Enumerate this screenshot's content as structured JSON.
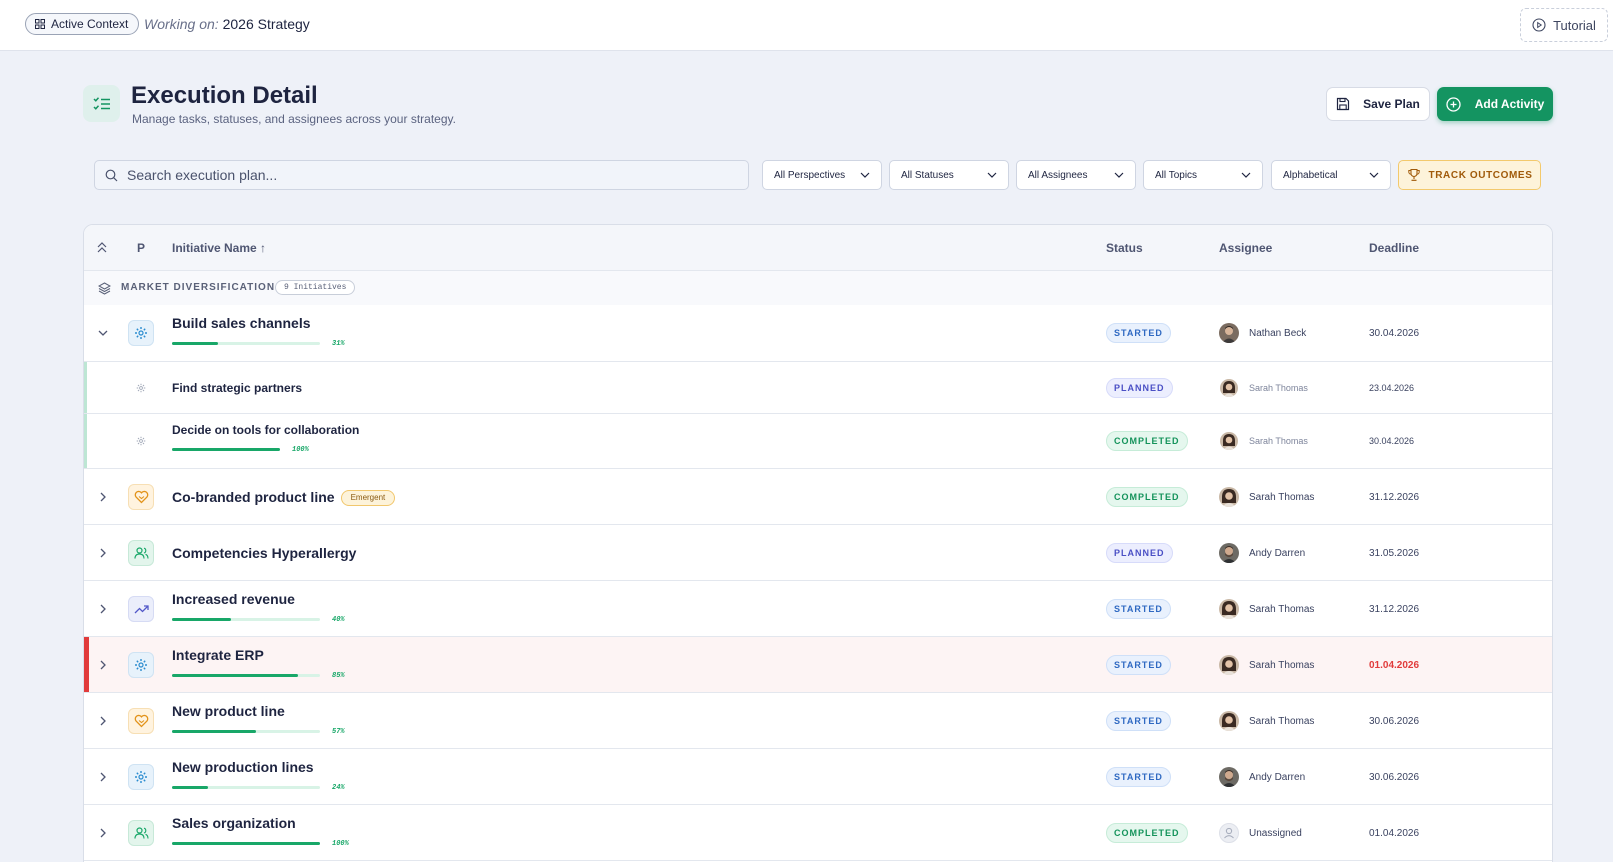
{
  "topbar": {
    "context_label": "Active Context",
    "working_prefix": "Working on:",
    "working_value": "2026 Strategy",
    "tutorial_label": "Tutorial"
  },
  "header": {
    "title": "Execution Detail",
    "subtitle": "Manage tasks, statuses, and assignees across your strategy.",
    "save_label": "Save Plan",
    "add_label": "Add Activity"
  },
  "filters": {
    "search_placeholder": "Search execution plan...",
    "perspectives": "All Perspectives",
    "statuses": "All Statuses",
    "assignees": "All Assignees",
    "topics": "All Topics",
    "sort": "Alphabetical",
    "track_label": "TRACK OUTCOMES"
  },
  "table": {
    "columns": {
      "p": "P",
      "name": "Initiative Name ↑",
      "status": "Status",
      "assignee": "Assignee",
      "deadline": "Deadline"
    },
    "group": {
      "name": "MARKET DIVERSIFICATION",
      "count": "9 Initiatives"
    },
    "rows": [
      {
        "name": "Build sales channels",
        "status": "STARTED",
        "assignee": "Nathan Beck",
        "deadline": "30.04.2026",
        "progress_pct": "31%",
        "progress": 0.31
      },
      {
        "name": "Find strategic partners",
        "status": "PLANNED",
        "assignee": "Sarah Thomas",
        "deadline": "23.04.2026"
      },
      {
        "name": "Decide on tools for collaboration",
        "status": "COMPLETED",
        "assignee": "Sarah Thomas",
        "deadline": "30.04.2026",
        "progress_pct": "100%",
        "progress": 1.0
      },
      {
        "name": "Co-branded product line",
        "badge": "Emergent",
        "status": "COMPLETED",
        "assignee": "Sarah Thomas",
        "deadline": "31.12.2026"
      },
      {
        "name": "Competencies Hyperallergy",
        "status": "PLANNED",
        "assignee": "Andy Darren",
        "deadline": "31.05.2026"
      },
      {
        "name": "Increased revenue",
        "status": "STARTED",
        "assignee": "Sarah Thomas",
        "deadline": "31.12.2026",
        "progress_pct": "40%",
        "progress": 0.4
      },
      {
        "name": "Integrate ERP",
        "status": "STARTED",
        "assignee": "Sarah Thomas",
        "deadline": "01.04.2026",
        "progress_pct": "85%",
        "progress": 0.85
      },
      {
        "name": "New product line",
        "status": "STARTED",
        "assignee": "Sarah Thomas",
        "deadline": "30.06.2026",
        "progress_pct": "57%",
        "progress": 0.57
      },
      {
        "name": "New production lines",
        "status": "STARTED",
        "assignee": "Andy Darren",
        "deadline": "30.06.2026",
        "progress_pct": "24%",
        "progress": 0.24
      },
      {
        "name": "Sales organization",
        "status": "COMPLETED",
        "assignee": "Unassigned",
        "deadline": "01.04.2026",
        "progress_pct": "100%",
        "progress": 1.0
      }
    ]
  },
  "colors": {
    "accent": "#149461",
    "alert": "#e13b3b",
    "background": "#eef1f8"
  }
}
